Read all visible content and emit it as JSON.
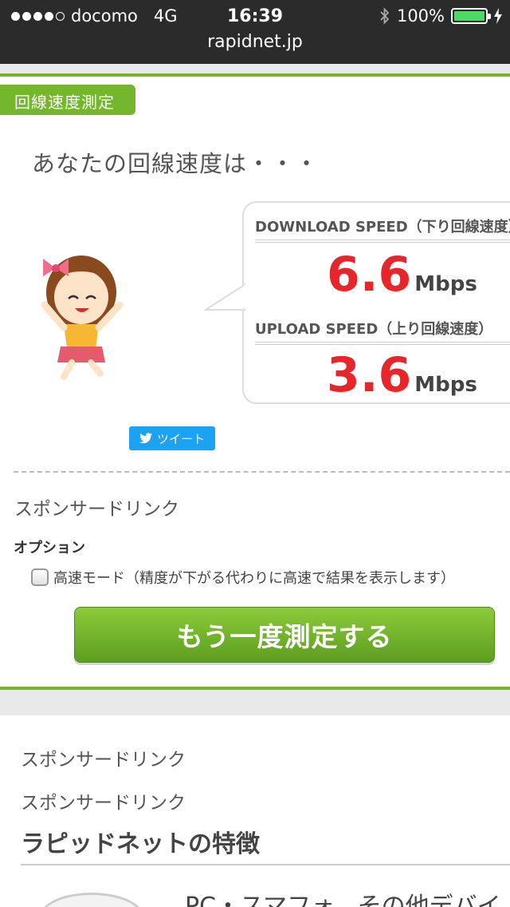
{
  "status_bar": {
    "carrier": "docomo",
    "network": "4G",
    "time": "16:39",
    "battery": "100%",
    "battery_level": 1.0
  },
  "url": "rapidnet.jp",
  "speed_test": {
    "section_tag": "回線速度測定",
    "headline": "あなたの回線速度は・・・",
    "download_label": "DOWNLOAD SPEED（下り回線速度）",
    "download_value": "6.6",
    "download_unit": "Mbps",
    "upload_label": "UPLOAD SPEED（上り回線速度）",
    "upload_value": "3.6",
    "upload_unit": "Mbps",
    "tweet_label": "ツイート",
    "sponsor_label": "スポンサードリンク",
    "options_title": "オプション",
    "fast_mode_label": "高速モード（精度が下がる代わりに高速で結果を表示します）",
    "fast_mode_checked": false,
    "remeasure_label": "もう一度測定する"
  },
  "lower": {
    "sponsor_1": "スポンサードリンク",
    "sponsor_2": "スポンサードリンク",
    "features_title": "ラピッドネットの特徴",
    "feature_text": "PC・スマフォ、その他デバイ"
  },
  "colors": {
    "accent_green": "#74b72c",
    "speed_red": "#e8252b",
    "twitter_blue": "#1da1f2"
  }
}
